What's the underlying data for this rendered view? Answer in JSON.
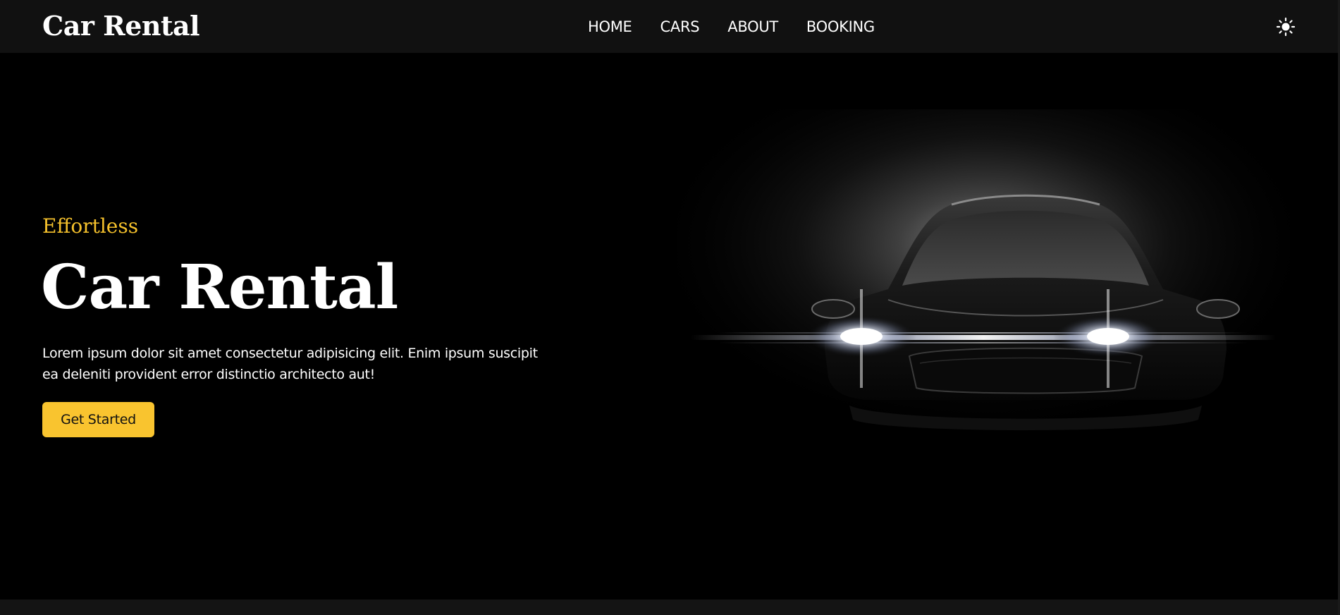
{
  "navbar": {
    "brand": "Car Rental",
    "links": [
      "HOME",
      "CARS",
      "ABOUT",
      "BOOKING"
    ],
    "theme_toggle_icon": "sun-icon"
  },
  "hero": {
    "kicker": "Effortless",
    "title": "Car Rental",
    "description": "Lorem ipsum dolor sit amet consectetur adipisicing elit. Enim ipsum suscipit ea deleniti provident error distinctio architecto aut!",
    "cta_label": "Get Started",
    "image_icon": "car-headlights-illustration"
  },
  "colors": {
    "accent": "#f9c42f",
    "kicker": "#f5c12c",
    "navbar_bg": "#111111",
    "page_bg": "#000000",
    "text": "#ffffff"
  }
}
